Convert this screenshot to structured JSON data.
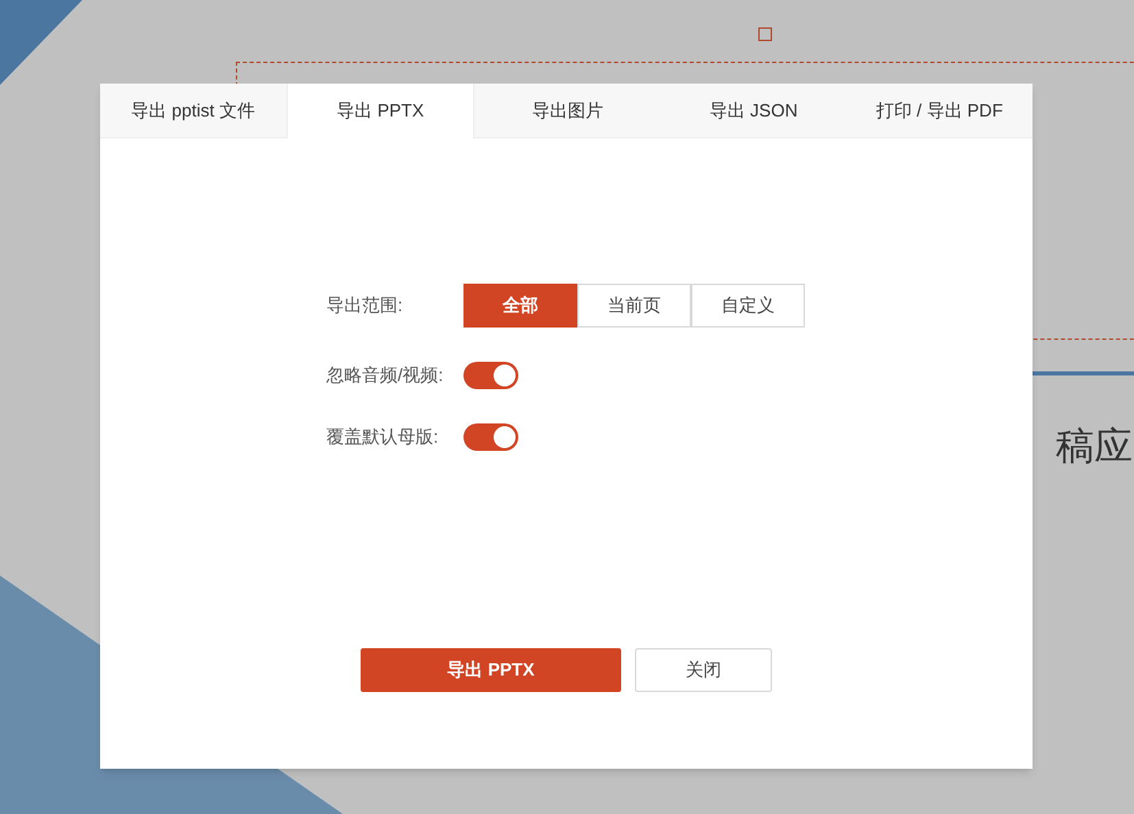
{
  "slide_text": "稿应",
  "tabs": [
    {
      "label": "导出 pptist 文件",
      "selected": false
    },
    {
      "label": "导出 PPTX",
      "selected": true
    },
    {
      "label": "导出图片",
      "selected": false
    },
    {
      "label": "导出 JSON",
      "selected": false
    },
    {
      "label": "打印 / 导出 PDF",
      "selected": false
    }
  ],
  "range": {
    "label": "导出范围:",
    "options": [
      {
        "label": "全部",
        "selected": true
      },
      {
        "label": "当前页",
        "selected": false
      },
      {
        "label": "自定义",
        "selected": false
      }
    ]
  },
  "switches": [
    {
      "label": "忽略音频/视频:",
      "on": true
    },
    {
      "label": "覆盖默认母版:",
      "on": true
    }
  ],
  "buttons": [
    {
      "label": "导出 PPTX",
      "kind": "primary"
    },
    {
      "label": "关闭",
      "kind": "secondary"
    }
  ]
}
